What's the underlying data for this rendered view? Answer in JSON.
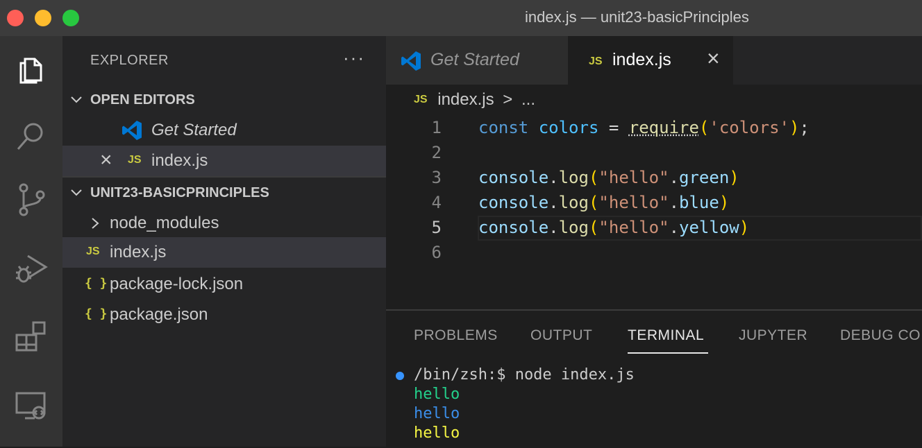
{
  "window": {
    "title": "index.js — unit23-basicPrinciples"
  },
  "activity_bar": [
    {
      "name": "explorer-icon",
      "active": true
    },
    {
      "name": "search-icon"
    },
    {
      "name": "source-control-icon"
    },
    {
      "name": "run-debug-icon"
    },
    {
      "name": "extensions-icon"
    },
    {
      "name": "remote-explorer-icon"
    }
  ],
  "sidebar": {
    "title": "EXPLORER",
    "more": "···",
    "open_editors": {
      "header": "OPEN EDITORS",
      "items": [
        {
          "label": "Get Started",
          "icon": "vscode-icon"
        },
        {
          "label": "index.js",
          "badge": "JS",
          "close": "×"
        }
      ]
    },
    "project": {
      "header": "UNIT23-BASICPRINCIPLES",
      "items": [
        {
          "label": "node_modules",
          "type": "folder"
        },
        {
          "label": "index.js",
          "badge": "JS"
        },
        {
          "label": "package-lock.json",
          "badge": "{ }"
        },
        {
          "label": "package.json",
          "badge": "{ }"
        }
      ]
    }
  },
  "tabs": [
    {
      "label": "Get Started"
    },
    {
      "label": "index.js",
      "badge": "JS",
      "close": "×"
    }
  ],
  "breadcrumb": {
    "badge": "JS",
    "file": "index.js",
    "sep": ">",
    "rest": "..."
  },
  "editor": {
    "line_numbers": [
      "1",
      "2",
      "3",
      "4",
      "5",
      "6"
    ],
    "active_line": 5
  },
  "panel": {
    "tabs": [
      "PROBLEMS",
      "OUTPUT",
      "TERMINAL",
      "JUPYTER",
      "DEBUG CO"
    ],
    "active_tab": "TERMINAL",
    "terminal": {
      "prompt": "/bin/zsh:$ node index.js",
      "output": [
        "hello",
        "hello",
        "hello"
      ],
      "output_colors": [
        "#23d18b",
        "#3b8eea",
        "#f5f543"
      ]
    }
  }
}
